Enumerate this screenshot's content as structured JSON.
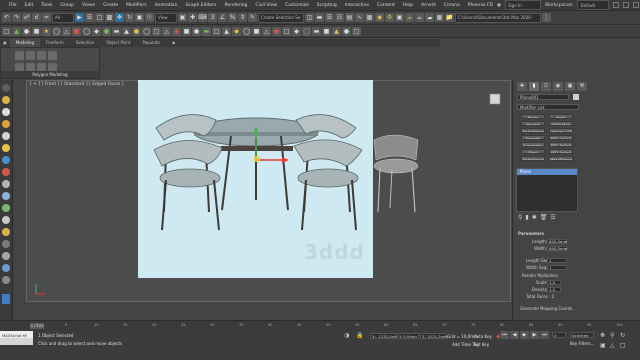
{
  "menu": [
    "File",
    "Edit",
    "Tools",
    "Group",
    "Views",
    "Create",
    "Modifiers",
    "Animation",
    "Graph Editors",
    "Rendering",
    "Civil View",
    "Customize",
    "Scripting",
    "Interactive",
    "Content",
    "Help",
    "Arnold",
    "Corona",
    "Phoenix FD"
  ],
  "account": {
    "user": "Sign In",
    "workspace": "Workspaces:",
    "workspace_value": "Default"
  },
  "toolbar": {
    "view_combo": "View",
    "selection_set": "Create Selection Se",
    "project_path": "C:\\Users\\l\\Documents\\3ds Max 2020"
  },
  "ribbon": {
    "tabs": [
      "Modeling",
      "Freeform",
      "Selection",
      "Object Paint",
      "Populate"
    ],
    "panel_label": "Polygon Modeling"
  },
  "viewport": {
    "label": "[ + ] [ Front ] [ Standard ] [ Edged Faces ]",
    "watermark": "3ddd"
  },
  "command_panel": {
    "object_name": "Plane001",
    "modifier_list": "Modifier List",
    "modifier_buttons": [
      [
        "Relax",
        "Push"
      ],
      [
        "Normal",
        "UVW Map"
      ],
      [
        "TurboSmooth",
        "Unwrap UVW"
      ],
      [
        "Smooth",
        "FFD 2x2x2"
      ],
      [
        "Symmetry",
        "FFD 3x3x3"
      ],
      [
        "Shell",
        "FFD 4x4x4"
      ],
      [
        "TurboSmooth",
        "MeshSmooth"
      ]
    ],
    "stack_item": "Plane",
    "rollout_title": "Parameters",
    "params": [
      {
        "label": "Length:",
        "value": "640,0mm"
      },
      {
        "label": "Width:",
        "value": "640,0mm"
      },
      {
        "label": "Length Segs:",
        "value": "1"
      },
      {
        "label": "Width Segs:",
        "value": "1"
      }
    ],
    "render_label": "Render Multipliers",
    "render_params": [
      {
        "label": "Scale:",
        "value": "1,0"
      },
      {
        "label": "Density:",
        "value": "1,0"
      }
    ],
    "total_faces": "Total Faces : 2",
    "mapping_checkbox": "Generate Mapping Coords."
  },
  "timeline": {
    "frame_display": "0 / 100",
    "ticks": [
      "0",
      "5",
      "10",
      "15",
      "20",
      "25",
      "30",
      "35",
      "40",
      "45",
      "50",
      "55",
      "60",
      "65",
      "70",
      "75",
      "80",
      "85",
      "90",
      "95",
      "100"
    ]
  },
  "status": {
    "maxscript": "MAXScript Mi",
    "line1": "1 Object Selected",
    "line2": "Click and drag to select and move objects",
    "x": "X: -1232,0mm",
    "y": "Y: 0,0mm",
    "z": "Z: 1015,7mm",
    "grid": "Grid = 10,0mm",
    "add_time_tag": "Add Time Tag",
    "auto_key": "Auto Key",
    "set_key": "Set Key",
    "selected": "Selected",
    "key_filters": "Key Filters...",
    "frame": "0"
  },
  "colors": {
    "accent": "#2a8fd6",
    "selection": "#5b88c9",
    "viewport_bg": "#4c4c4c",
    "photo_bg": "#cfe9f2"
  }
}
